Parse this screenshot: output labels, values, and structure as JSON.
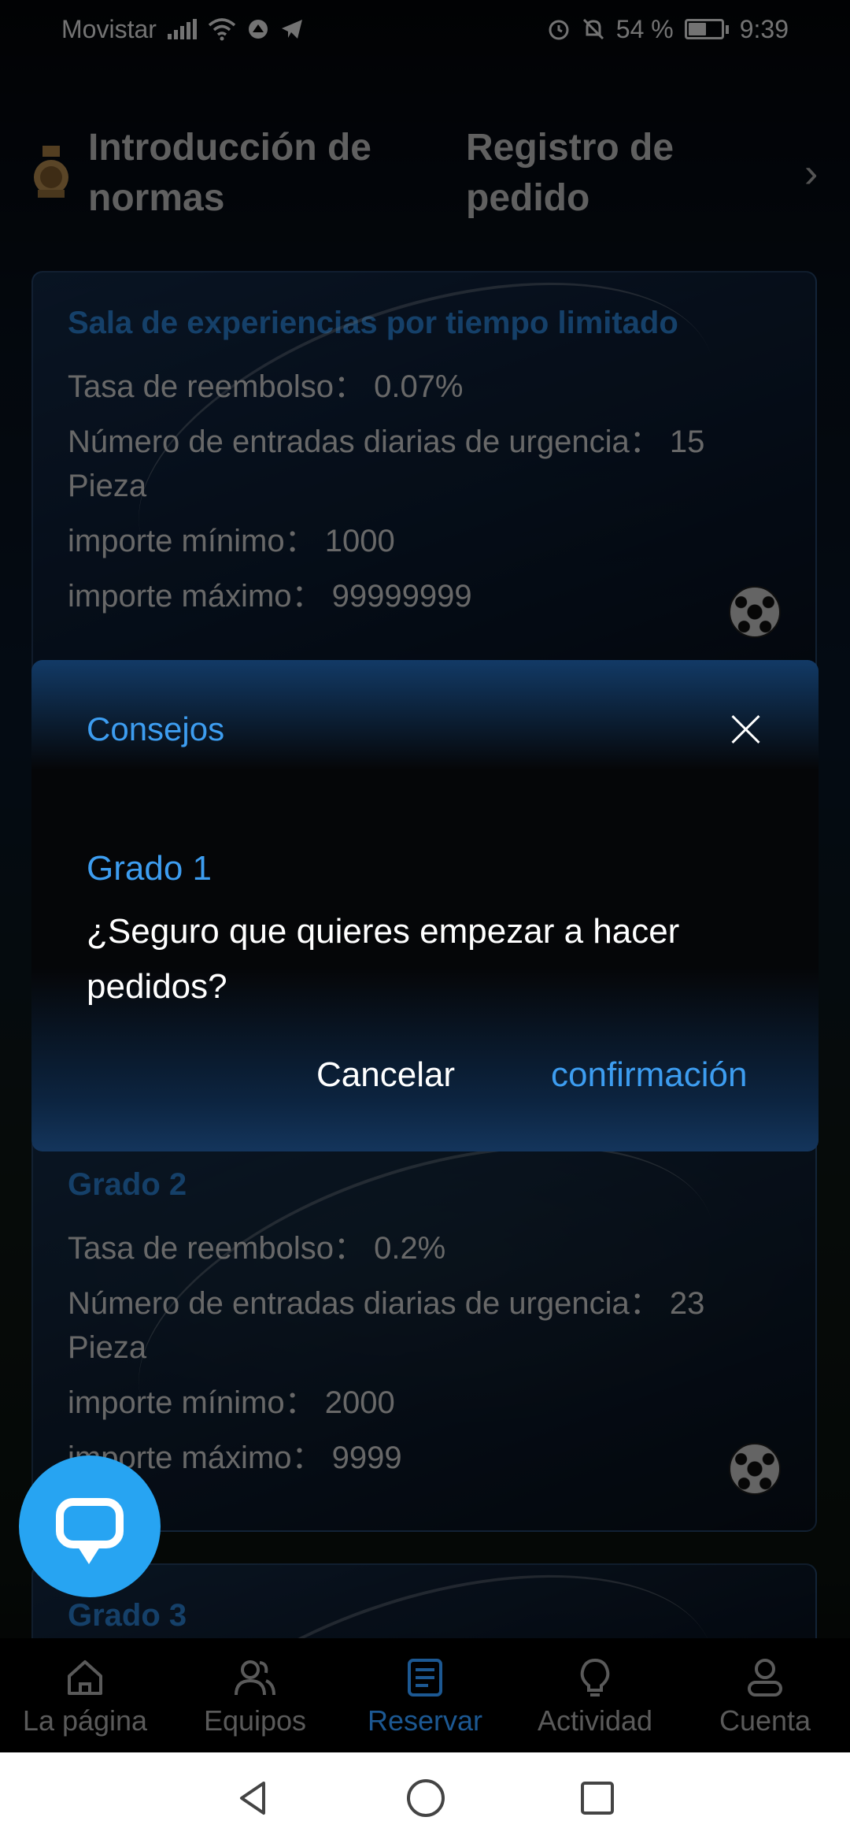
{
  "status_bar": {
    "carrier": "Movistar",
    "battery_percent": "54 %",
    "battery_level": 0.54,
    "time": "9:39",
    "icons": [
      "signal-icon",
      "wifi-icon",
      "sync-icon",
      "telegram-icon",
      "alarm-icon",
      "mute-icon",
      "battery-icon"
    ]
  },
  "top_nav": {
    "items": [
      {
        "label": "Introducción de normas",
        "icon": "medal-icon"
      },
      {
        "label": "Registro de pedido"
      }
    ]
  },
  "cards": [
    {
      "title": "Sala de experiencias por tiempo limitado",
      "refund_rate": "Tasa de reembolso：  0.07%",
      "daily_entries": "Número de entradas diarias de urgencia：  15 Pieza",
      "min_amount": "importe mínimo：  1000",
      "max_amount": "importe máximo：  99999999"
    },
    {
      "title": "Grado 2",
      "refund_rate": "Tasa de reembolso：  0.2%",
      "daily_entries": "Número de entradas diarias de urgencia：  23 Pieza",
      "min_amount": "importe mínimo：  2000",
      "max_amount": "importe máximo：  9999"
    },
    {
      "title": "Grado 3"
    }
  ],
  "modal": {
    "title": "Consejos",
    "grade": "Grado 1",
    "message": "¿Seguro que quieres empezar a hacer pedidos?",
    "cancel_label": "Cancelar",
    "confirm_label": "confirmación"
  },
  "tab_bar": {
    "items": [
      {
        "label": "La página",
        "icon": "home-icon"
      },
      {
        "label": "Equipos",
        "icon": "team-icon"
      },
      {
        "label": "Reservar",
        "icon": "reserve-icon",
        "active": true
      },
      {
        "label": "Actividad",
        "icon": "lightbulb-icon"
      },
      {
        "label": "Cuenta",
        "icon": "user-icon"
      }
    ]
  },
  "colors": {
    "accent": "#2f8ee8",
    "chat_fab": "#27a4f2"
  }
}
